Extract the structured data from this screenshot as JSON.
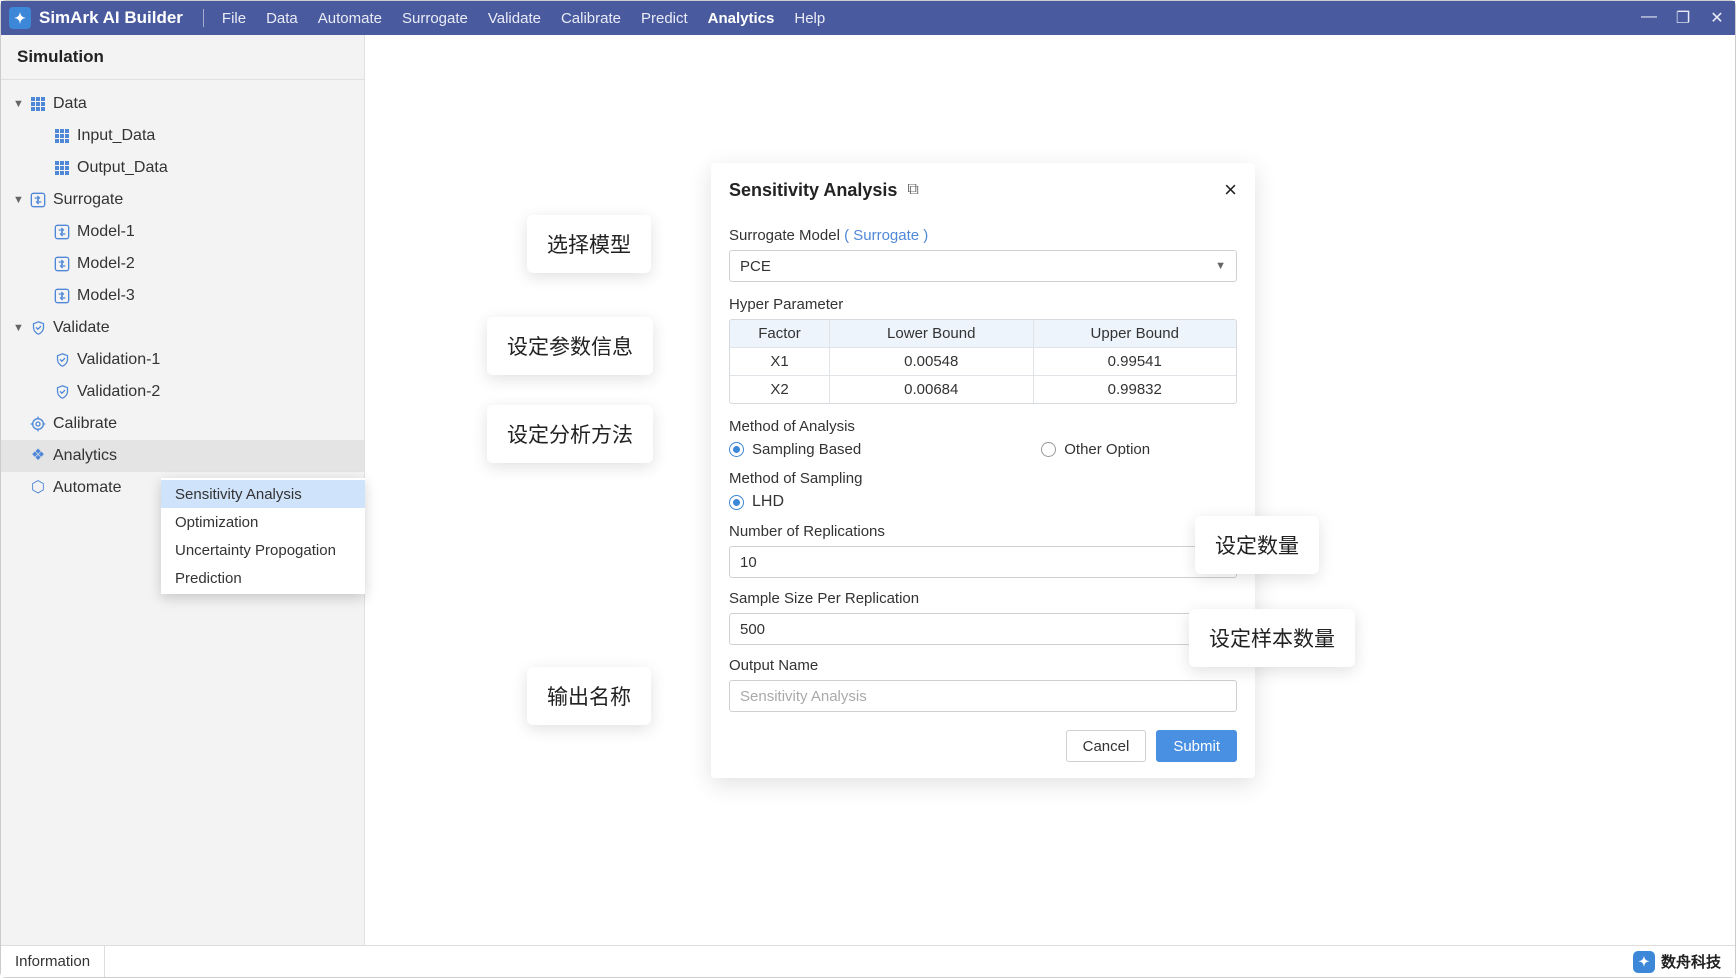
{
  "app": {
    "title": "SimArk AI Builder"
  },
  "menu": [
    "File",
    "Data",
    "Automate",
    "Surrogate",
    "Validate",
    "Calibrate",
    "Predict",
    "Analytics",
    "Help"
  ],
  "menu_active": "Analytics",
  "sidebar": {
    "title": "Simulation",
    "data": {
      "label": "Data",
      "items": [
        "Input_Data",
        "Output_Data"
      ]
    },
    "surrogate": {
      "label": "Surrogate",
      "items": [
        "Model-1",
        "Model-2",
        "Model-3"
      ]
    },
    "validate": {
      "label": "Validate",
      "items": [
        "Validation-1",
        "Validation-2"
      ]
    },
    "calibrate": "Calibrate",
    "analytics": "Analytics",
    "automate": "Automate"
  },
  "context_menu": [
    "Sensitivity Analysis",
    "Optimization",
    "Uncertainty Propogation",
    "Prediction"
  ],
  "dialog": {
    "title": "Sensitivity Analysis",
    "surrogate_label": "Surrogate Model",
    "surrogate_link": "( Surrogate )",
    "surrogate_value": "PCE",
    "hyper_label": "Hyper Parameter",
    "table": {
      "headers": [
        "Factor",
        "Lower Bound",
        "Upper Bound"
      ],
      "rows": [
        {
          "factor": "X1",
          "lower": "0.00548",
          "upper": "0.99541"
        },
        {
          "factor": "X2",
          "lower": "0.00684",
          "upper": "0.99832"
        }
      ]
    },
    "method_analysis_label": "Method of Analysis",
    "method_analysis_opts": [
      "Sampling Based",
      "Other Option"
    ],
    "method_sampling_label": "Method of Sampling",
    "method_sampling_opt": "LHD",
    "num_rep_label": "Number of Replications",
    "num_rep_value": "10",
    "sample_size_label": "Sample Size Per Replication",
    "sample_size_value": "500",
    "output_label": "Output Name",
    "output_placeholder": "Sensitivity Analysis",
    "cancel": "Cancel",
    "submit": "Submit"
  },
  "callouts": {
    "model": "选择模型",
    "params": "设定参数信息",
    "method": "设定分析方法",
    "count": "设定数量",
    "samples": "设定样本数量",
    "output": "输出名称"
  },
  "status": {
    "info": "Information",
    "brand": "数舟科技"
  }
}
